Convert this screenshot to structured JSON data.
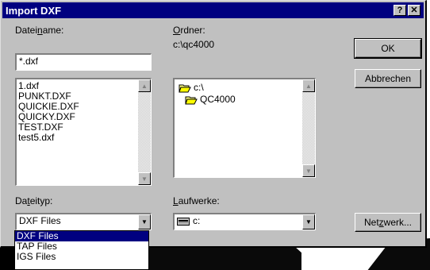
{
  "window": {
    "title": "Import DXF",
    "help_label": "?",
    "close_label": "✕"
  },
  "filename": {
    "label_pre": "Datei",
    "label_u": "n",
    "label_post": "ame:",
    "value": "*.dxf",
    "files": [
      "1.dxf",
      "PUNKT.DXF",
      "QUICKIE.DXF",
      "QUICKY.DXF",
      "TEST.DXF",
      "test5.dxf"
    ]
  },
  "folder": {
    "label_u": "O",
    "label_post": "rdner:",
    "path": "c:\\qc4000",
    "tree": [
      {
        "label": "c:\\",
        "icon": "open-folder-icon"
      },
      {
        "label": "QC4000",
        "icon": "open-folder-icon"
      }
    ]
  },
  "filetype": {
    "label_pre": "Da",
    "label_u": "t",
    "label_post": "eityp:",
    "selected": "DXF Files",
    "options": [
      "DXF Files",
      "TAP Files",
      "IGS Files"
    ]
  },
  "drives": {
    "label_u": "L",
    "label_post": "aufwerke:",
    "selected": "c:",
    "icon": "drive-icon"
  },
  "buttons": {
    "ok": "OK",
    "cancel": "Abbrechen",
    "network_pre": "Net",
    "network_u": "z",
    "network_post": "werk..."
  },
  "colors": {
    "titlebar": "#000080",
    "face": "#c0c0c0",
    "selection": "#000080"
  }
}
